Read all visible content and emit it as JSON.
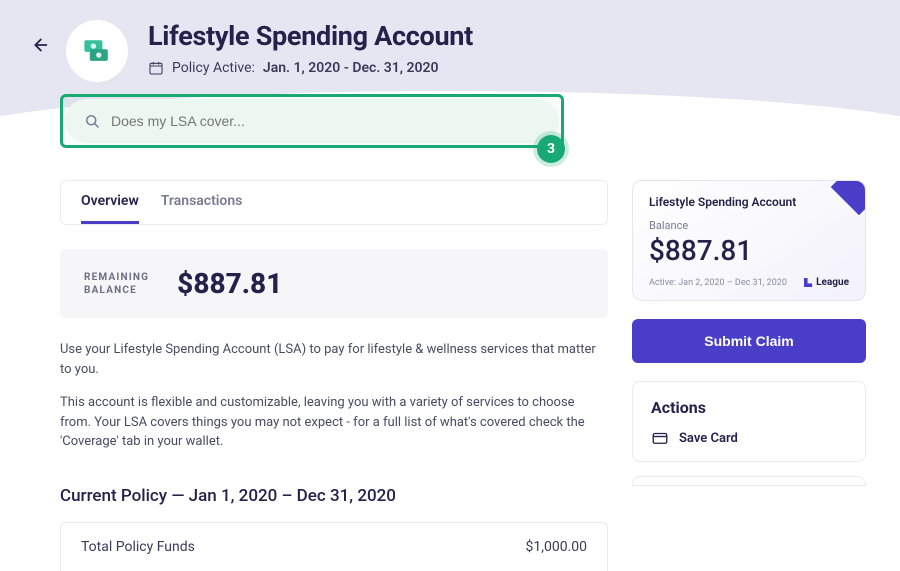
{
  "header": {
    "title": "Lifestyle Spending Account",
    "policy_label": "Policy Active:",
    "policy_dates": "Jan. 1, 2020 - Dec. 31, 2020"
  },
  "search": {
    "placeholder": "Does my LSA cover...",
    "step_badge": "3"
  },
  "tabs": {
    "overview": "Overview",
    "transactions": "Transactions"
  },
  "balance": {
    "label_line1": "REMAINING",
    "label_line2": "BALANCE",
    "amount": "$887.81"
  },
  "description": {
    "p1": "Use your Lifestyle Spending Account (LSA) to pay for lifestyle & wellness services that matter to you.",
    "p2": "This account is flexible and customizable, leaving you with a variety of services to choose from. Your LSA covers things you may not expect - for a full list of what's covered check the 'Coverage' tab in your wallet."
  },
  "current_policy": {
    "heading": "Current Policy — Jan 1, 2020 – Dec 31, 2020",
    "row_label": "Total Policy Funds",
    "row_value": "$1,000.00"
  },
  "card": {
    "title": "Lifestyle Spending Account",
    "balance_label": "Balance",
    "balance": "$887.81",
    "active_range": "Active: Jan 2, 2020 – Dec 31, 2020",
    "brand": "League"
  },
  "submit_button": "Submit Claim",
  "actions": {
    "title": "Actions",
    "save_card": "Save Card"
  },
  "colors": {
    "accent": "#4a3ec9",
    "highlight": "#19a974"
  }
}
